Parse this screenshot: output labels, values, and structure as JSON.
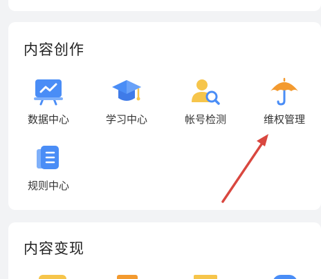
{
  "sections": [
    {
      "title": "内容创作",
      "items": [
        {
          "label": "数据中心",
          "icon": "chart-board-icon"
        },
        {
          "label": "学习中心",
          "icon": "graduation-cap-icon"
        },
        {
          "label": "帐号检测",
          "icon": "account-search-icon"
        },
        {
          "label": "维权管理",
          "icon": "umbrella-icon"
        },
        {
          "label": "规则中心",
          "icon": "rules-book-icon"
        }
      ]
    },
    {
      "title": "内容变现"
    }
  ],
  "colors": {
    "page_bg": "#f2f3f5",
    "card_bg": "#ffffff",
    "blue": "#4a8df6",
    "orange": "#f39a2f",
    "yellow": "#f6c54b",
    "arrow": "#d9473f"
  }
}
